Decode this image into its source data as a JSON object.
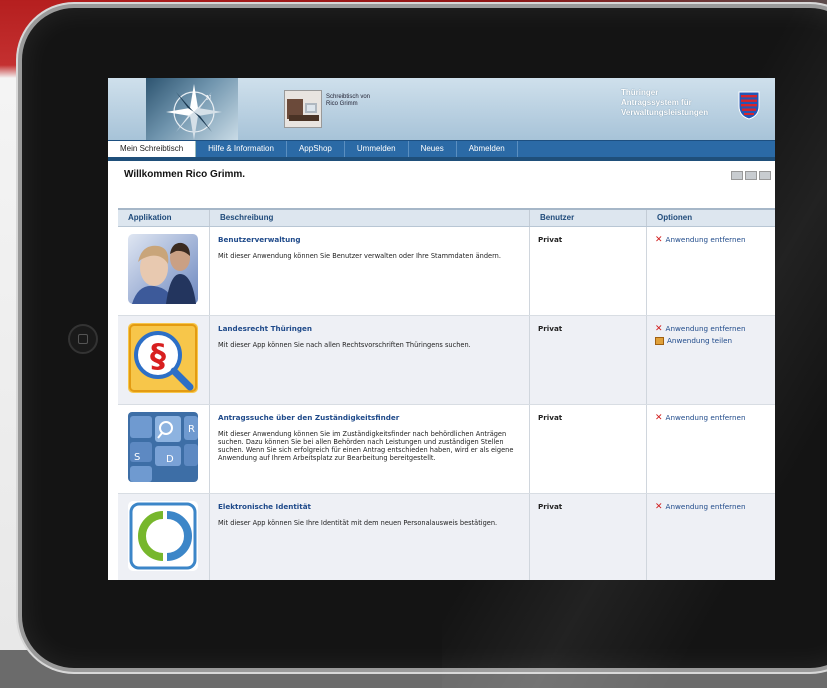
{
  "header": {
    "desk_line1": "Schreibtisch von",
    "desk_line2": "Rico Grimm",
    "system_title_line1": "Thüringer",
    "system_title_line2": "Antragssystem für",
    "system_title_line3": "Verwaltungsleistungen"
  },
  "nav": {
    "items": [
      "Mein Schreibtisch",
      "Hilfe & Information",
      "AppShop",
      "Ummelden",
      "Neues",
      "Abmelden"
    ],
    "active": "Mein Schreibtisch"
  },
  "welcome": "Willkommen Rico Grimm.",
  "table": {
    "headers": [
      "Applikation",
      "Beschreibung",
      "Benutzer",
      "Optionen"
    ],
    "rows": [
      {
        "icon": "people-icon",
        "title": "Benutzerverwaltung",
        "description": "Mit dieser Anwendung können Sie Benutzer verwalten oder Ihre Stammdaten ändern.",
        "user": "Privat",
        "options": [
          "Anwendung entfernen"
        ]
      },
      {
        "icon": "law-search-icon",
        "title": "Landesrecht Thüringen",
        "description": "Mit dieser App können Sie nach allen Rechtsvorschriften Thüringens suchen.",
        "user": "Privat",
        "options": [
          "Anwendung entfernen",
          "Anwendung teilen"
        ]
      },
      {
        "icon": "keyboard-search-icon",
        "title": "Antragssuche über den Zuständigkeitsfinder",
        "description": "Mit dieser Anwendung können Sie im Zuständigkeitsfinder nach behördlichen Anträgen suchen. Dazu können Sie bei allen Behörden nach Leistungen und zuständigen Stellen suchen. Wenn Sie sich erfolgreich für einen Antrag entschieden haben, wird er als eigene Anwendung auf Ihrem Arbeitsplatz zur Bearbeitung bereitgestellt.",
        "user": "Privat",
        "options": [
          "Anwendung entfernen"
        ]
      },
      {
        "icon": "eid-icon",
        "title": "Elektronische Identität",
        "description": "Mit dieser App können Sie Ihre Identität mit dem neuen Personalausweis bestätigen.",
        "user": "Privat",
        "options": [
          "Anwendung entfernen"
        ]
      }
    ]
  },
  "colors": {
    "nav_bg": "#2b6aa6",
    "link": "#1f4a8a",
    "remove_icon": "#d01a1a",
    "row_alt": "#eef0f5"
  }
}
